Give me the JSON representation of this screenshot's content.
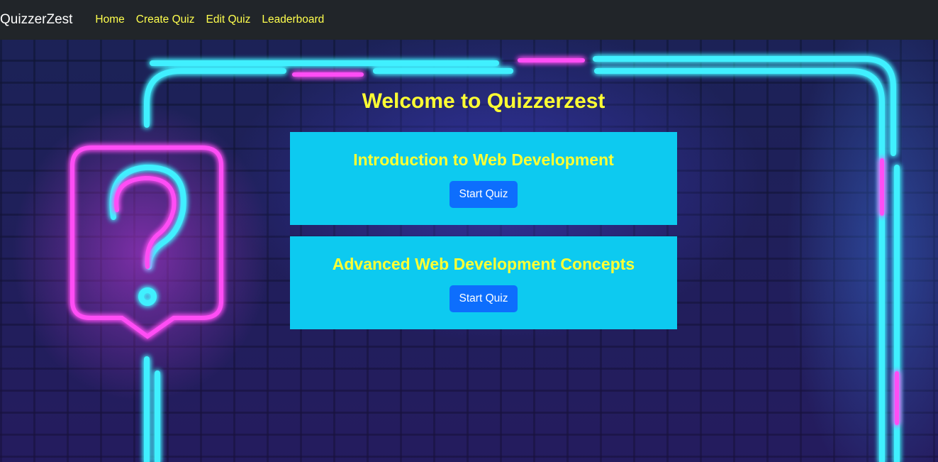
{
  "navbar": {
    "brand": "QuizzerZest",
    "links": [
      "Home",
      "Create Quiz",
      "Edit Quiz",
      "Leaderboard"
    ]
  },
  "main": {
    "title": "Welcome to Quizzerzest",
    "quizzes": [
      {
        "title": "Introduction to Web Development",
        "button": "Start Quiz"
      },
      {
        "title": "Advanced Web Development Concepts",
        "button": "Start Quiz"
      }
    ]
  },
  "background": {
    "image": "neon question mark on brick wall",
    "icon": "question-mark-icon"
  },
  "colors": {
    "navbar": "#212529",
    "nav_link": "#ffff4d",
    "card": "#0dcaf0",
    "card_title": "#ffff33",
    "button": "#0d6efd",
    "neon_cyan": "#3ff0ff",
    "neon_pink": "#ff4df5"
  }
}
